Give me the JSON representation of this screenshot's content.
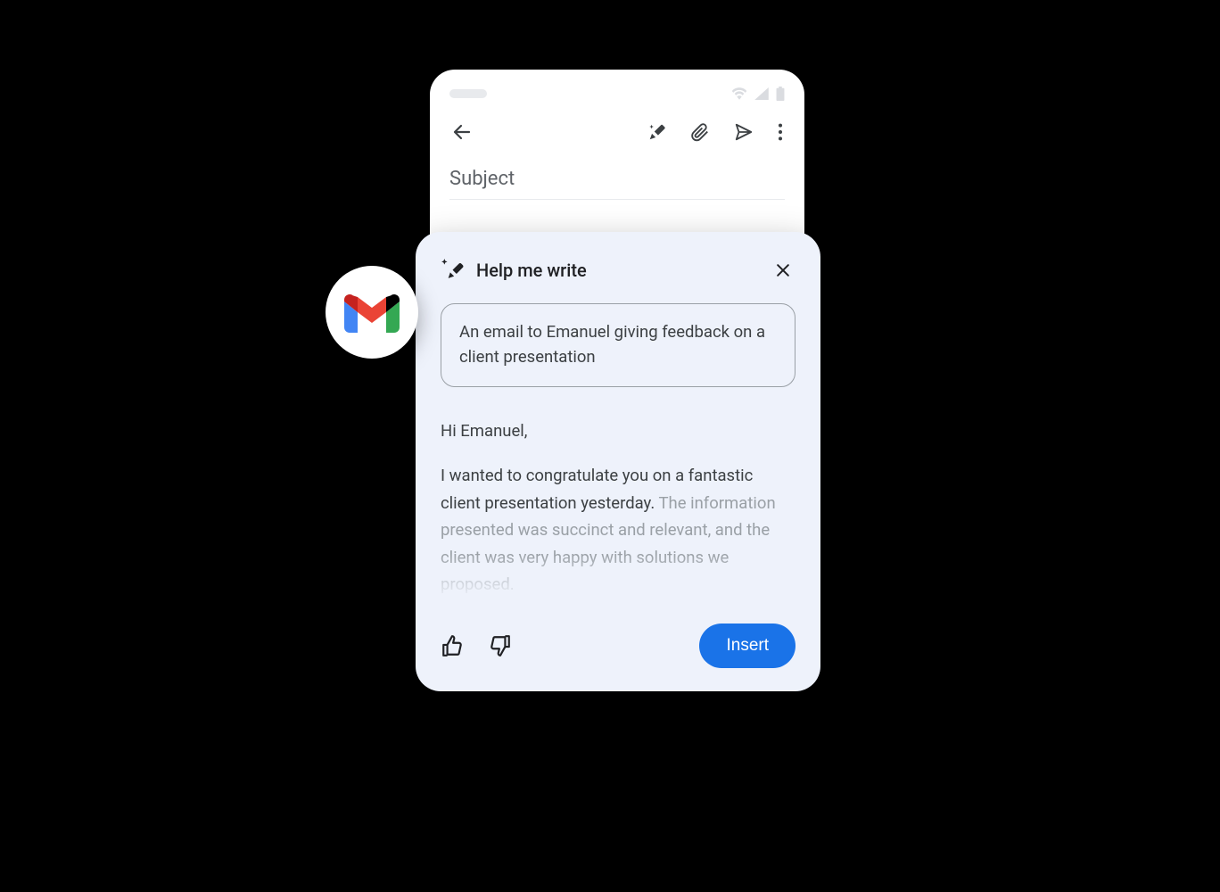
{
  "compose": {
    "subject_placeholder": "Subject"
  },
  "panel": {
    "title": "Help me write",
    "prompt": "An email to Emanuel giving feedback on a client presentation",
    "generated": {
      "greeting": "Hi Emanuel,",
      "line1": "I wanted to congratulate you on a fantastic client presentation yesterday.",
      "line2": "The information presented was succinct and relevant, and the client was very happy with solutions we proposed."
    },
    "insert_label": "Insert"
  }
}
